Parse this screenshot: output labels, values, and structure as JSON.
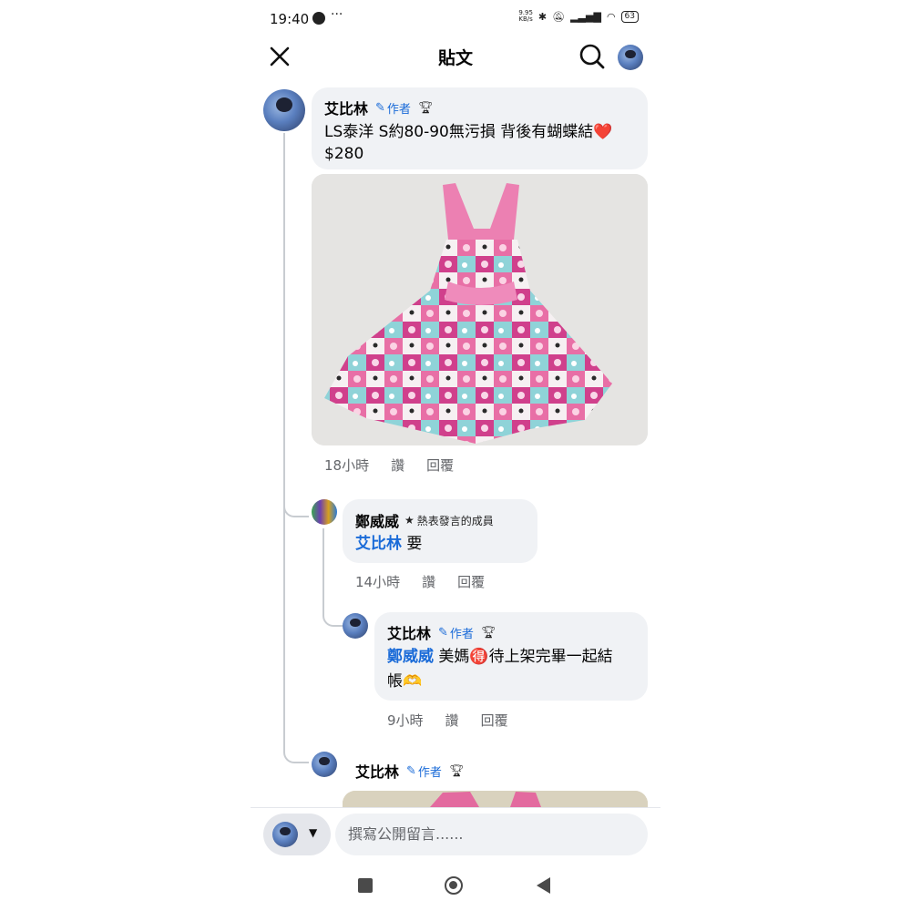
{
  "status_bar": {
    "time": "19:40",
    "speed_value": "9.95",
    "speed_unit": "KB/s",
    "battery": "63"
  },
  "header": {
    "title": "貼文"
  },
  "comments": [
    {
      "author": "艾比林",
      "badge": "作者",
      "text": "LS泰洋 S約80-90無污損 背後有蝴蝶結❤️",
      "text2": "$280",
      "time": "18小時",
      "like": "讚",
      "reply": "回覆"
    },
    {
      "author": "鄭威威",
      "badge": "熱表發言的成員",
      "mention": "艾比林",
      "text": "要",
      "time": "14小時",
      "like": "讚",
      "reply": "回覆"
    },
    {
      "author": "艾比林",
      "badge": "作者",
      "mention": "鄭威威",
      "text": "美媽🉐待上架完畢一起結",
      "text2": "帳🫶",
      "time": "9小時",
      "like": "讚",
      "reply": "回覆"
    },
    {
      "author": "艾比林",
      "badge": "作者"
    }
  ],
  "composer": {
    "placeholder": "撰寫公開留言......"
  },
  "colors": {
    "link": "#1a6bd8",
    "bubble": "#f0f2f5",
    "meta": "#65676b"
  }
}
